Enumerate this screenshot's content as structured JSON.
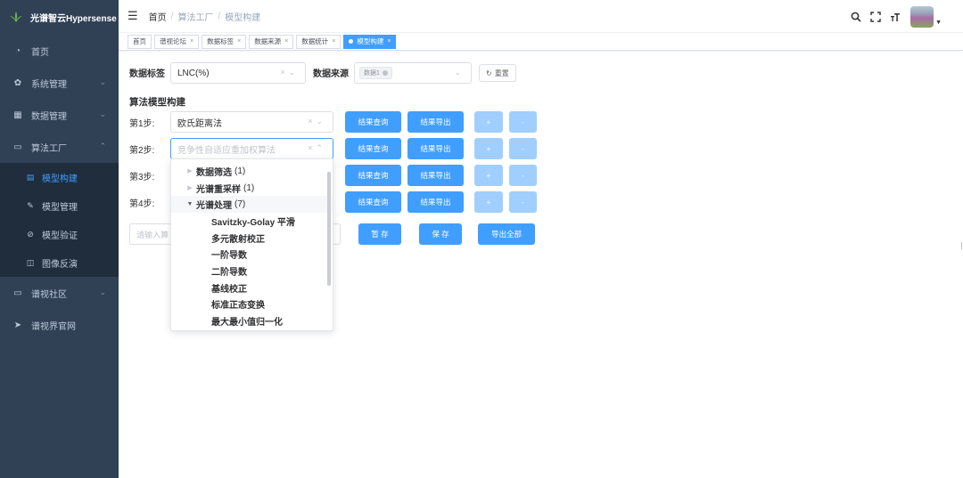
{
  "brand": {
    "name": "光谱智云Hypersense"
  },
  "sidebar": {
    "items": [
      {
        "label": "首页",
        "icon": "dashboard-icon"
      },
      {
        "label": "系统管理",
        "icon": "gear-icon"
      },
      {
        "label": "数据管理",
        "icon": "grid-icon"
      },
      {
        "label": "算法工厂",
        "icon": "monitor-icon"
      },
      {
        "label": "谱视社区",
        "icon": "window-icon"
      },
      {
        "label": "谱视界官网",
        "icon": "send-icon"
      }
    ],
    "subitems": [
      {
        "label": "模型构建",
        "icon": "table-icon"
      },
      {
        "label": "模型管理",
        "icon": "edit-icon"
      },
      {
        "label": "模型验证",
        "icon": "check-circle-icon"
      },
      {
        "label": "图像反演",
        "icon": "image-icon"
      }
    ]
  },
  "navbar": {
    "breadcrumb": [
      "首页",
      "算法工厂",
      "模型构建"
    ]
  },
  "tags": [
    {
      "label": "首页"
    },
    {
      "label": "谱视论坛"
    },
    {
      "label": "数据标签"
    },
    {
      "label": "数据来源"
    },
    {
      "label": "数据统计"
    },
    {
      "label": "模型构建"
    }
  ],
  "filters": {
    "data_label_title": "数据标签",
    "data_label_value": "LNC(%)",
    "data_source_title": "数据来源",
    "data_source_chip": "数据1",
    "reset_label": "重置"
  },
  "builder": {
    "title": "算法模型构建",
    "steps": [
      {
        "label": "第1步:",
        "value": "欧氏距离法",
        "placeholder": ""
      },
      {
        "label": "第2步:",
        "value": "",
        "placeholder": "竞争性自适应重加权算法"
      },
      {
        "label": "第3步:",
        "value": "",
        "placeholder": ""
      },
      {
        "label": "第4步:",
        "value": "",
        "placeholder": ""
      }
    ],
    "query_label": "结果查询",
    "export_label": "结果导出",
    "plus_label": "+",
    "minus_label": "-",
    "name_placeholder": "请输入算",
    "save_draft_label": "暂 存",
    "save_label": "保 存",
    "export_all_label": "导出全部"
  },
  "dropdown": {
    "groups": [
      {
        "label": "数据筛选",
        "count": "(1)",
        "expanded": false
      },
      {
        "label": "光谱重采样",
        "count": "(1)",
        "expanded": false
      },
      {
        "label": "光谱处理",
        "count": "(7)",
        "expanded": true
      }
    ],
    "leaves": [
      "Savitzky-Golay 平滑",
      "多元散射校正",
      "一阶导数",
      "二阶导数",
      "基线校正",
      "标准正态变换",
      "最大最小值归一化"
    ]
  },
  "colors": {
    "primary": "#409eff",
    "sidebar": "#304156",
    "sidebar_sub": "#1f2d3d"
  }
}
